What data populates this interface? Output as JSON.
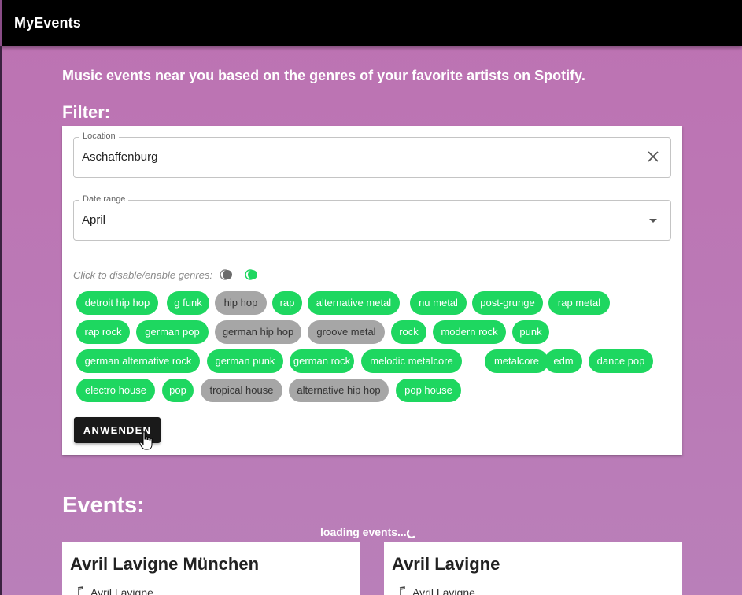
{
  "app": {
    "title": "MyEvents"
  },
  "intro": "Music events near you based on the genres of your favorite artists on Spotify.",
  "filter": {
    "heading": "Filter:",
    "location": {
      "label": "Location",
      "value": "Aschaffenburg"
    },
    "date_range": {
      "label": "Date range",
      "value": "April"
    },
    "genre_hint": "Click to disable/enable genres:",
    "genres": [
      [
        {
          "label": "detroit hip hop",
          "enabled": true
        },
        {
          "label": "g funk",
          "enabled": true
        },
        {
          "label": "hip hop",
          "enabled": false
        },
        {
          "label": "rap",
          "enabled": true
        },
        {
          "label": "alternative metal",
          "enabled": true
        },
        {
          "label": "nu metal",
          "enabled": true
        },
        {
          "label": "post-grunge",
          "enabled": true
        },
        {
          "label": "rap metal",
          "enabled": true
        }
      ],
      [
        {
          "label": "rap rock",
          "enabled": true
        },
        {
          "label": "german pop",
          "enabled": true
        },
        {
          "label": "german hip hop",
          "enabled": false
        },
        {
          "label": "groove metal",
          "enabled": false
        },
        {
          "label": "rock",
          "enabled": true
        },
        {
          "label": "modern rock",
          "enabled": true
        },
        {
          "label": "punk",
          "enabled": true
        }
      ],
      [
        {
          "label": "german alternative rock",
          "enabled": true
        },
        {
          "label": "german punk",
          "enabled": true
        },
        {
          "label": "german rock",
          "enabled": true
        },
        {
          "label": "melodic metalcore",
          "enabled": true
        },
        {
          "label": "metalcore",
          "enabled": true
        },
        {
          "label": "edm",
          "enabled": true
        },
        {
          "label": "dance pop",
          "enabled": true
        }
      ],
      [
        {
          "label": "electro house",
          "enabled": true
        },
        {
          "label": "pop",
          "enabled": true
        },
        {
          "label": "tropical house",
          "enabled": false
        },
        {
          "label": "alternative hip hop",
          "enabled": false
        },
        {
          "label": "pop house",
          "enabled": true
        }
      ]
    ],
    "apply_label": "ANWENDEN"
  },
  "events": {
    "heading": "Events:",
    "loading": "loading events...",
    "cards": [
      {
        "title": "Avril Lavigne München",
        "artist": "Avril Lavigne"
      },
      {
        "title": "Avril Lavigne",
        "artist": "Avril Lavigne"
      }
    ]
  },
  "colors": {
    "chip_enabled": "#1ed760",
    "chip_disabled": "#a6a6a6",
    "appbar": "#000000",
    "background": "#bd72b2"
  }
}
